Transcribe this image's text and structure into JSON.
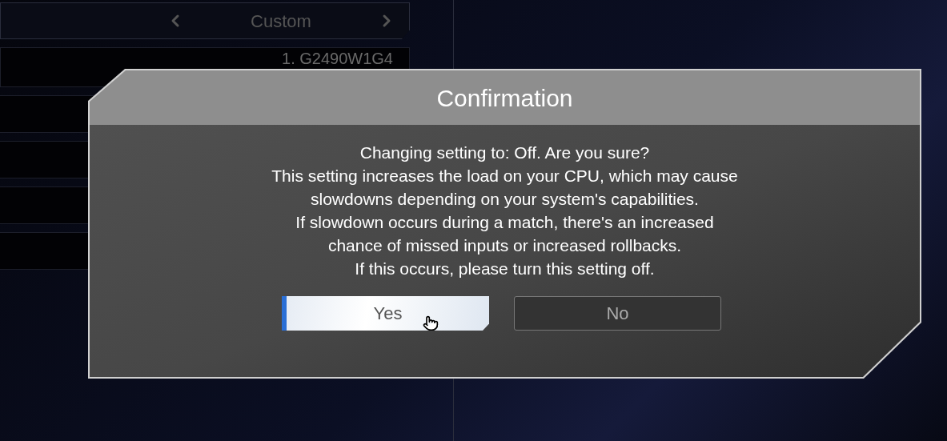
{
  "background_settings": {
    "selector_value": "Custom",
    "display_value": "1. G2490W1G4"
  },
  "dialog": {
    "title": "Confirmation",
    "message_lines": [
      "Changing setting to: Off. Are you sure?",
      "This setting increases the load on your CPU, which may cause",
      "slowdowns depending on your system's capabilities.",
      "If slowdown occurs during a match, there's an increased",
      "chance of missed inputs or increased rollbacks.",
      "If this occurs, please turn this setting off."
    ],
    "buttons": [
      {
        "label": "Yes",
        "selected": true
      },
      {
        "label": "No",
        "selected": false
      }
    ]
  }
}
